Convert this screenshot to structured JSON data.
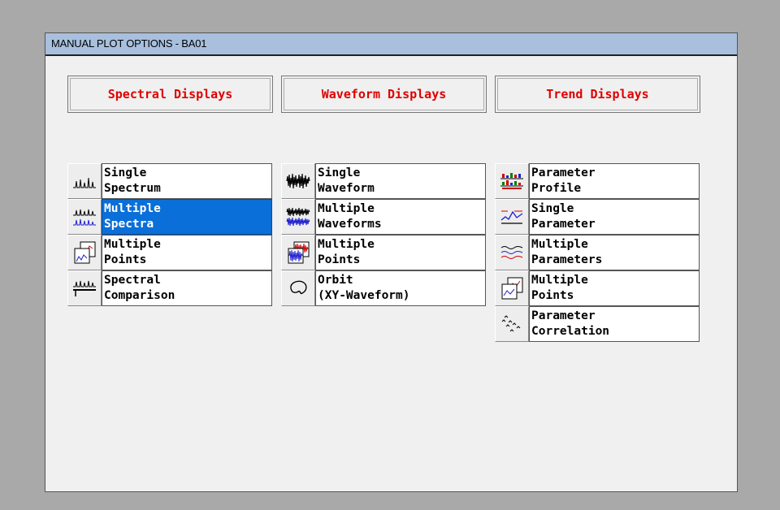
{
  "window": {
    "title": "MANUAL PLOT OPTIONS - BA01"
  },
  "sections": [
    {
      "label": "Spectral Displays"
    },
    {
      "label": "Waveform Displays"
    },
    {
      "label": "Trend Displays"
    }
  ],
  "spectral": [
    {
      "line1": "Single",
      "line2": "Spectrum",
      "icon": "single-spectrum-icon",
      "selected": false
    },
    {
      "line1": "Multiple",
      "line2": "Spectra",
      "icon": "multiple-spectra-icon",
      "selected": true
    },
    {
      "line1": "Multiple",
      "line2": "Points",
      "icon": "multiple-points-icon",
      "selected": false
    },
    {
      "line1": "Spectral",
      "line2": "Comparison",
      "icon": "spectral-comparison-icon",
      "selected": false
    }
  ],
  "waveform": [
    {
      "line1": "Single",
      "line2": "Waveform",
      "icon": "single-waveform-icon",
      "selected": false
    },
    {
      "line1": "Multiple",
      "line2": "Waveforms",
      "icon": "multiple-waveforms-icon",
      "selected": false
    },
    {
      "line1": "Multiple",
      "line2": "Points",
      "icon": "multiple-points-icon",
      "selected": false
    },
    {
      "line1": "Orbit",
      "line2": "(XY-Waveform)",
      "icon": "orbit-icon",
      "selected": false
    }
  ],
  "trend": [
    {
      "line1": "Parameter",
      "line2": "Profile",
      "icon": "parameter-profile-icon",
      "selected": false
    },
    {
      "line1": "Single",
      "line2": "Parameter",
      "icon": "single-parameter-icon",
      "selected": false
    },
    {
      "line1": "Multiple",
      "line2": "Parameters",
      "icon": "multiple-parameters-icon",
      "selected": false
    },
    {
      "line1": "Multiple",
      "line2": "Points",
      "icon": "multiple-points-icon",
      "selected": false
    },
    {
      "line1": "Parameter",
      "line2": "Correlation",
      "icon": "parameter-correlation-icon",
      "selected": false
    }
  ],
  "colors": {
    "section_text": "#e00000",
    "selected_bg": "#0a6fd8",
    "titlebar_bg": "#a8c0de"
  }
}
